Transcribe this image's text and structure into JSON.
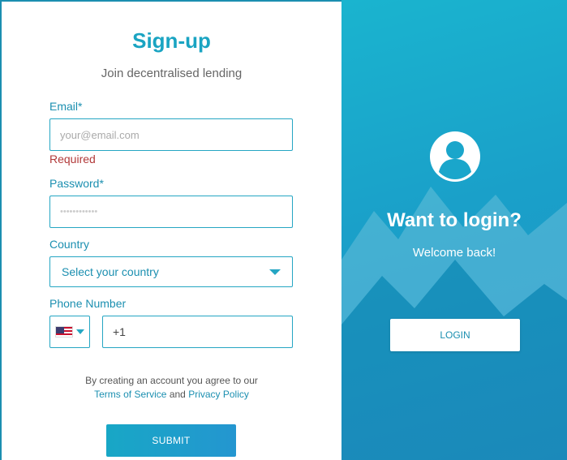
{
  "signup": {
    "title": "Sign-up",
    "subtitle": "Join decentralised lending",
    "email_label": "Email*",
    "email_placeholder": "your@email.com",
    "email_error": "Required",
    "password_label": "Password*",
    "password_placeholder": "••••••••••••",
    "country_label": "Country",
    "country_select": "Select your country",
    "phone_label": "Phone Number",
    "phone_flag": "US",
    "phone_value": "+1",
    "terms_prefix": "By creating an account you agree to our",
    "terms_link": "Terms of Service",
    "terms_and": "and",
    "privacy_link": "Privacy Policy",
    "submit_label": "SUBMIT"
  },
  "login_panel": {
    "title": "Want to login?",
    "subtitle": "Welcome back!",
    "button_label": "LOGIN",
    "avatar_icon": "user-circle-icon"
  },
  "colors": {
    "accent": "#1aa4c2",
    "error": "#b23a3a",
    "panel_gradient_start": "#1ab4cf",
    "panel_gradient_end": "#1f93c6"
  }
}
